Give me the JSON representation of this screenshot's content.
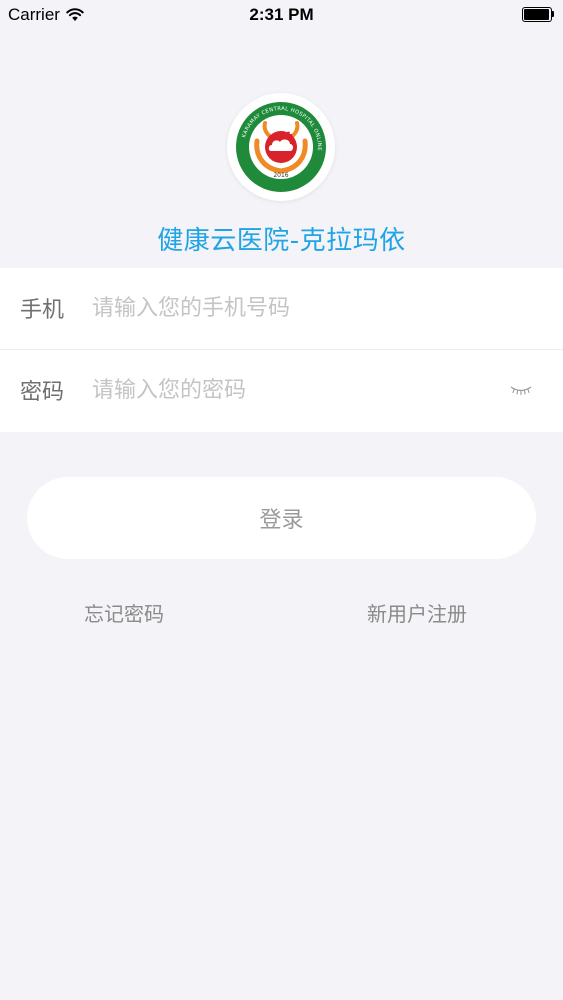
{
  "status_bar": {
    "carrier": "Carrier",
    "time": "2:31 PM"
  },
  "header": {
    "title": "健康云医院-克拉玛依",
    "logo": {
      "year_text": "2016",
      "ring_text": "KARAMAY CENTRAL HOSPITAL ONLINE"
    }
  },
  "form": {
    "phone": {
      "label": "手机",
      "placeholder": "请输入您的手机号码",
      "value": ""
    },
    "password": {
      "label": "密码",
      "placeholder": "请输入您的密码",
      "value": ""
    }
  },
  "actions": {
    "login_label": "登录",
    "forgot_password": "忘记密码",
    "register": "新用户注册"
  },
  "colors": {
    "accent": "#20a4e6",
    "logo_green": "#1f8a3a",
    "logo_red": "#d8232a",
    "logo_orange": "#f08a24",
    "background": "#f4f3f8"
  }
}
